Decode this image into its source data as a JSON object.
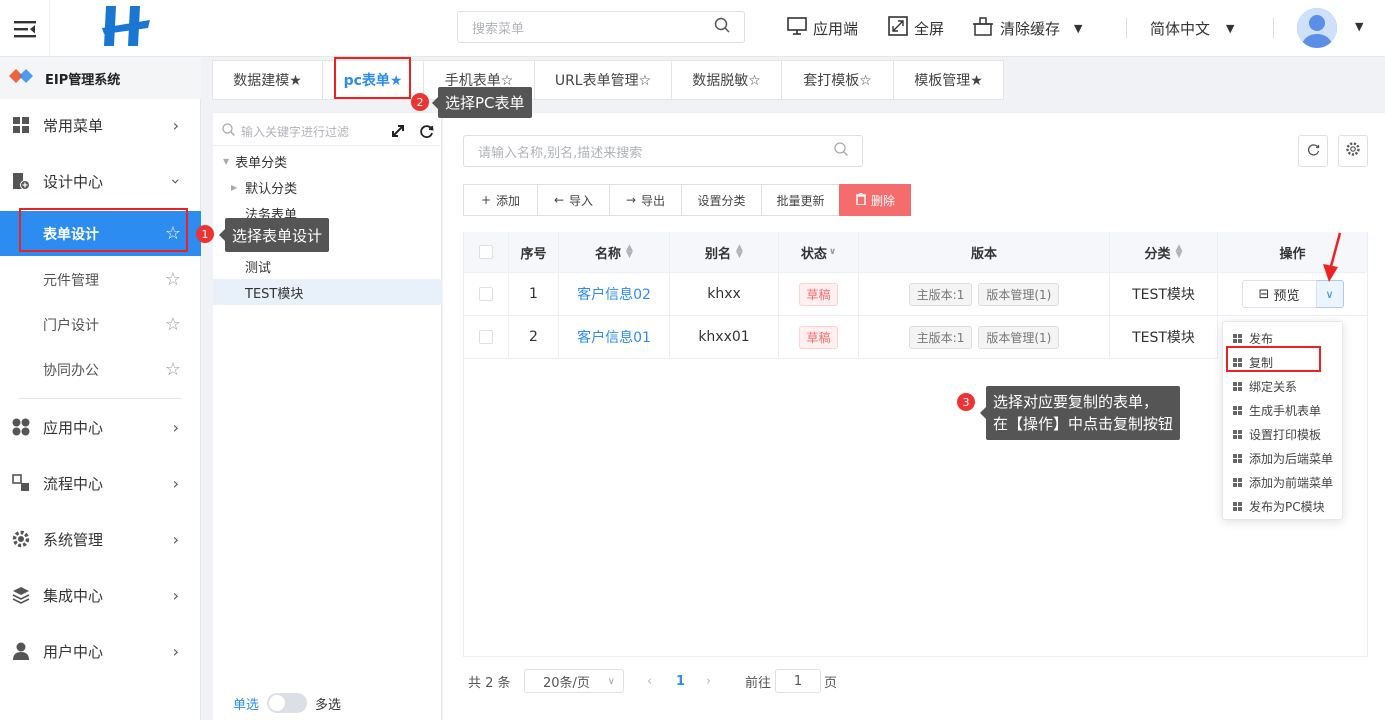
{
  "header": {
    "search_placeholder": "搜索菜单",
    "app_end": "应用端",
    "fullscreen": "全屏",
    "clear_cache": "清除缓存",
    "language": "简体中文"
  },
  "brand": {
    "title": "EIP管理系统"
  },
  "sidebar": {
    "items": [
      {
        "label": "常用菜单"
      },
      {
        "label": "设计中心"
      },
      {
        "label": "应用中心"
      },
      {
        "label": "流程中心"
      },
      {
        "label": "系统管理"
      },
      {
        "label": "集成中心"
      },
      {
        "label": "用户中心"
      }
    ],
    "sub_items": [
      {
        "label": "表单设计"
      },
      {
        "label": "元件管理"
      },
      {
        "label": "门户设计"
      },
      {
        "label": "协同办公"
      }
    ]
  },
  "tabs": [
    {
      "label": "数据建模★"
    },
    {
      "label": "pc表单★"
    },
    {
      "label": "手机表单☆"
    },
    {
      "label": "URL表单管理☆"
    },
    {
      "label": "数据脱敏☆"
    },
    {
      "label": "套打模板☆"
    },
    {
      "label": "模板管理★"
    }
  ],
  "tree": {
    "filter_placeholder": "输入关键字进行过滤",
    "root": "表单分类",
    "nodes": [
      "默认分类",
      "法务表单",
      "测试",
      "TEST模块"
    ],
    "single": "单选",
    "multi": "多选"
  },
  "main": {
    "search_placeholder": "请输入名称,别名,描述来搜索",
    "toolbar": [
      "添加",
      "导入",
      "导出",
      "设置分类",
      "批量更新",
      "删除"
    ],
    "columns": [
      "序号",
      "名称",
      "别名",
      "状态",
      "版本",
      "分类",
      "操作"
    ],
    "rows": [
      {
        "index": "1",
        "name": "客户信息02",
        "alias": "khxx",
        "status": "草稿",
        "version": "主版本:1",
        "version_mgmt": "版本管理(1)",
        "category": "TEST模块"
      },
      {
        "index": "2",
        "name": "客户信息01",
        "alias": "khxx01",
        "status": "草稿",
        "version": "主版本:1",
        "version_mgmt": "版本管理(1)",
        "category": "TEST模块"
      }
    ],
    "preview": "预览",
    "dropdown": [
      "发布",
      "复制",
      "绑定关系",
      "生成手机表单",
      "设置打印模板",
      "添加为后端菜单",
      "添加为前端菜单",
      "发布为PC模块"
    ]
  },
  "pagination": {
    "total": "共 2 条",
    "page_size": "20条/页",
    "current": "1",
    "goto": "前往",
    "goto_value": "1",
    "page_unit": "页"
  },
  "annotations": {
    "step1_num": "1",
    "step1": "选择表单设计",
    "step2_num": "2",
    "step2": "选择PC表单",
    "step3_num": "3",
    "step3_line1": "选择对应要复制的表单，",
    "step3_line2": "在【操作】中点击复制按钮"
  },
  "colors": {
    "primary": "#2d8cf0",
    "danger": "#f56c6c",
    "annotation_red": "#e22"
  }
}
